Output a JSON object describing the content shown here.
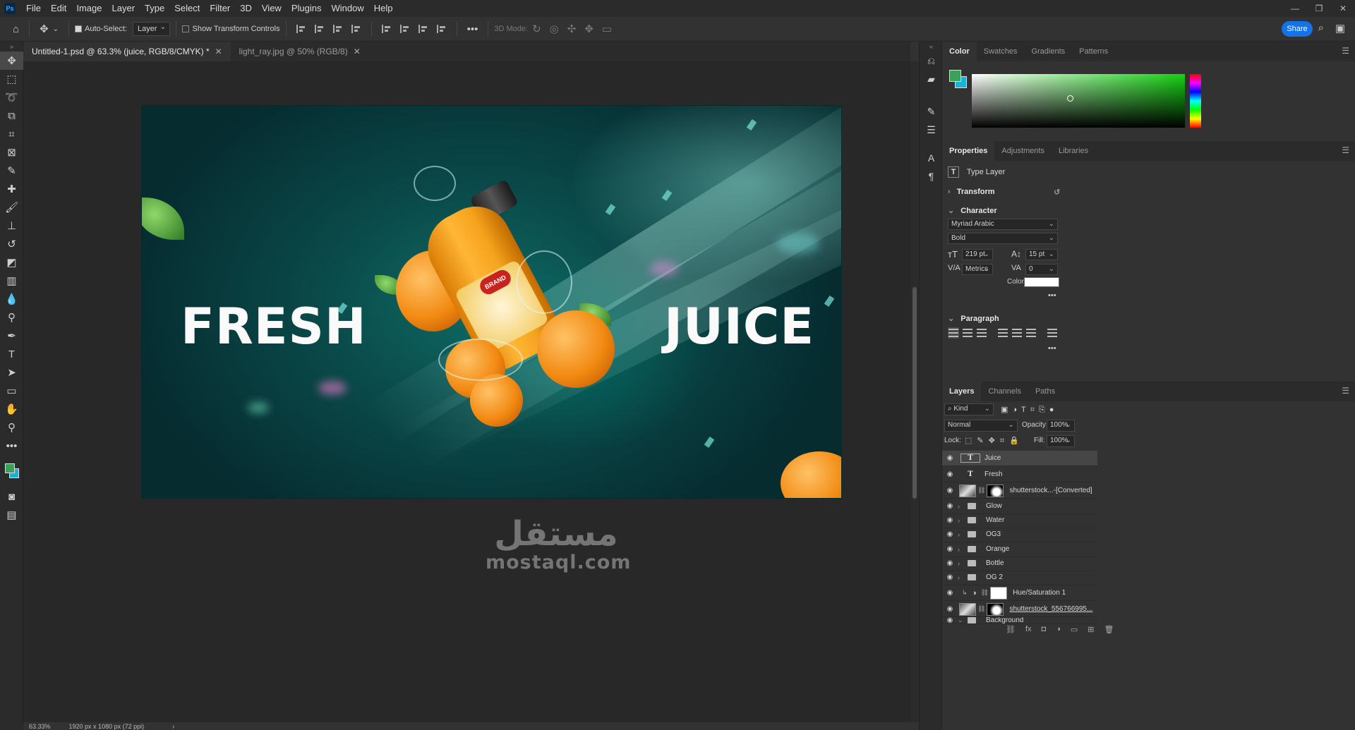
{
  "menu": {
    "logo": "Ps",
    "items": [
      "File",
      "Edit",
      "Image",
      "Layer",
      "Type",
      "Select",
      "Filter",
      "3D",
      "View",
      "Plugins",
      "Window",
      "Help"
    ]
  },
  "options": {
    "auto_select_label": "Auto-Select:",
    "auto_select_value": "Layer",
    "transform_controls_label": "Show Transform Controls",
    "mode_3d_label": "3D Mode:",
    "share_label": "Share"
  },
  "tabs": [
    {
      "label": "Untitled-1.psd @ 63.3% (juice, RGB/8/CMYK) *",
      "active": true
    },
    {
      "label": "light_ray.jpg @ 50% (RGB/8)",
      "active": false
    }
  ],
  "canvas": {
    "text_left": "FRESH",
    "text_right": "JUICE",
    "bottle_brand": "BRAND"
  },
  "watermark": {
    "arabic": "مستقل",
    "latin": "mostaql.com"
  },
  "status": {
    "zoom": "63.33%",
    "doc_size": "1920 px x 1080 px (72 ppi)"
  },
  "color_panel": {
    "tabs": [
      "Color",
      "Swatches",
      "Gradients",
      "Patterns"
    ],
    "foreground": "#3aa05a",
    "background": "#18b3d6"
  },
  "properties": {
    "tabs": [
      "Properties",
      "Adjustments",
      "Libraries"
    ],
    "layer_type": "Type Layer",
    "transform_label": "Transform",
    "character_label": "Character",
    "font_family": "Myriad Arabic",
    "font_style": "Bold",
    "font_size": "219 pt",
    "leading": "15 pt",
    "kerning": "Metrics",
    "tracking": "0",
    "color_label": "Color",
    "paragraph_label": "Paragraph"
  },
  "layers": {
    "tabs": [
      "Layers",
      "Channels",
      "Paths"
    ],
    "filter": "Kind",
    "blend_mode": "Normal",
    "opacity_label": "Opacity:",
    "opacity": "100%",
    "lock_label": "Lock:",
    "fill_label": "Fill:",
    "fill": "100%",
    "items": [
      {
        "name": "Juice",
        "kind": "text",
        "selected": true
      },
      {
        "name": "Fresh",
        "kind": "text",
        "selected": false
      },
      {
        "name": "shutterstock...-[Converted]",
        "kind": "image-mask",
        "selected": false
      },
      {
        "name": "Glow",
        "kind": "group",
        "selected": false
      },
      {
        "name": "Water",
        "kind": "group",
        "selected": false
      },
      {
        "name": "OG3",
        "kind": "group",
        "selected": false
      },
      {
        "name": "Orange",
        "kind": "group",
        "selected": false
      },
      {
        "name": "Bottle",
        "kind": "group",
        "selected": false
      },
      {
        "name": "OG 2",
        "kind": "group",
        "selected": false
      },
      {
        "name": "Hue/Saturation 1",
        "kind": "adjustment",
        "selected": false
      },
      {
        "name": "shutterstock_556766995...",
        "kind": "image-mask",
        "selected": false
      },
      {
        "name": "Background",
        "kind": "group",
        "selected": false
      }
    ]
  }
}
